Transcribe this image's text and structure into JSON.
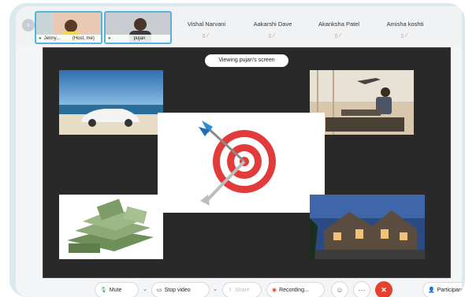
{
  "participants": {
    "video_tiles": [
      {
        "name": "Jenny...",
        "tag": "(Host, me)"
      },
      {
        "name": "pujan"
      }
    ],
    "name_tiles": [
      {
        "name": "Vishal Narvani"
      },
      {
        "name": "Aakarshi Dave"
      },
      {
        "name": "Akanksha Patel"
      },
      {
        "name": "Amisha koshti"
      }
    ]
  },
  "share": {
    "banner": "Viewing pujan's screen"
  },
  "toolbar": {
    "mute_label": "Mute",
    "video_label": "Stop video",
    "share_label": "Share",
    "recording_label": "Recording...",
    "participants_label": "Participan"
  },
  "colors": {
    "highlight_border": "#56b2e0",
    "end_call": "#e5422e",
    "mic_green": "#2e9b45",
    "target_red": "#e23b3b"
  }
}
